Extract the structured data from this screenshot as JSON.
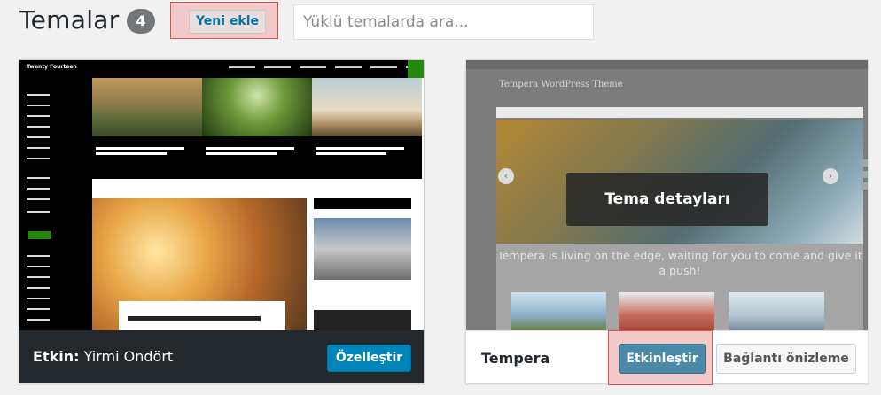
{
  "header": {
    "title": "Temalar",
    "count": "4",
    "add_new_label": "Yeni ekle",
    "search_placeholder": "Yüklü temalarda ara..."
  },
  "themes": [
    {
      "name": "Yirmi Ondört",
      "status_label": "Etkin:",
      "actions": {
        "customize": "Özelleştir"
      },
      "screenshot_alt": "Twenty Fourteen"
    },
    {
      "name": "Tempera",
      "details_label": "Tema detayları",
      "screenshot_text": "Tempera is living on the edge, waiting for you to come and give it a push!",
      "screenshot_site_title": "Tempera WordPress Theme",
      "actions": {
        "activate": "Etkinleştir",
        "live_preview": "Bağlantı önizleme"
      }
    }
  ],
  "colors": {
    "accent": "#0085ba",
    "highlight": "#f2c9c9",
    "dark_footer": "#23282d"
  }
}
